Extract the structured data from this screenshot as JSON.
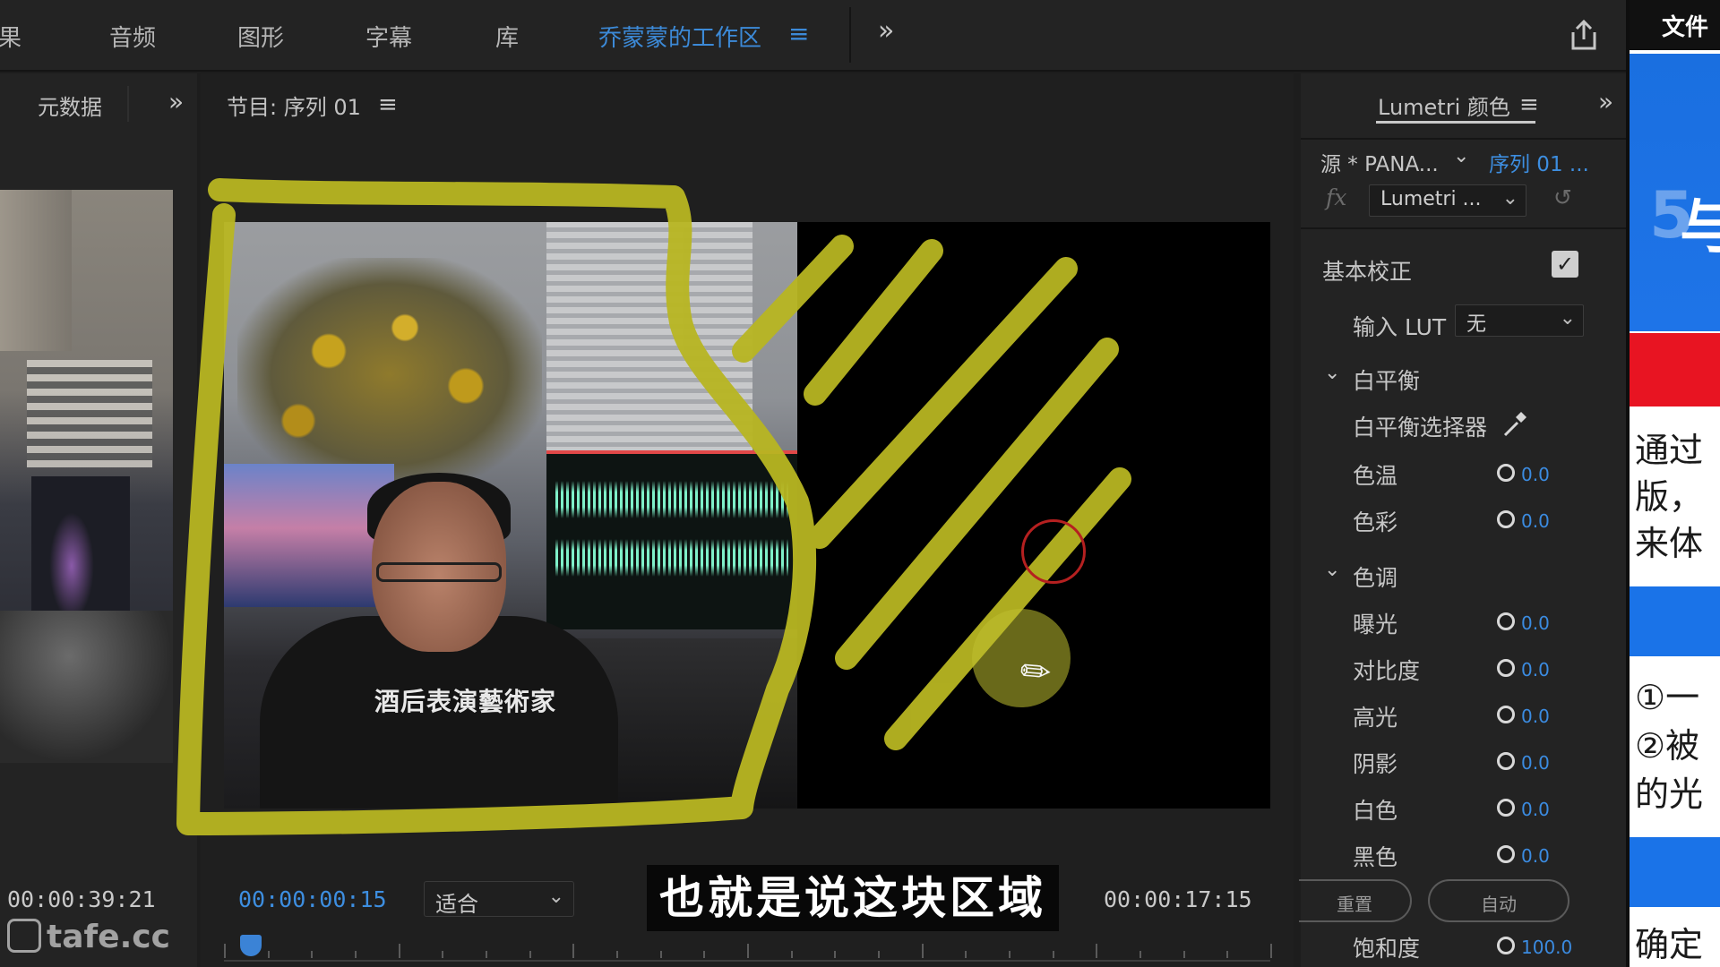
{
  "workspaces": {
    "tabs": [
      "果",
      "音频",
      "图形",
      "字幕",
      "库",
      "乔蒙蒙的工作区"
    ],
    "active_index": 5,
    "menu_glyph": "≡",
    "overflow_glyph": "»",
    "share_icon": "share-icon"
  },
  "left_panel": {
    "title": "元数据",
    "overflow_glyph": "»",
    "timecode": "00:00:39:21"
  },
  "program_monitor": {
    "title": "节目: 序列 01",
    "menu_glyph": "≡",
    "shirt_text": "酒后表演藝術家",
    "current_timecode": "00:00:00:15",
    "fit_label": "适合",
    "duration_timecode": "00:00:17:15",
    "playhead_fraction": 0.015
  },
  "subtitle": "也就是说这块区域",
  "watermark": "tafe.cc",
  "lumetri": {
    "title": "Lumetri 颜色",
    "menu_glyph": "≡",
    "overflow_glyph": "»",
    "source_label": "源 * PANA...",
    "sequence_label": "序列 01 ...",
    "fx_label": "fx",
    "effect_label": "Lumetri ...",
    "basic_correction": "基本校正",
    "basic_enabled": true,
    "input_lut_label": "输入 LUT",
    "input_lut_value": "无",
    "white_balance_header": "白平衡",
    "white_balance_picker": "白平衡选择器",
    "tone_header": "色调",
    "rows": [
      {
        "label": "色温",
        "value": "0.0"
      },
      {
        "label": "色彩",
        "value": "0.0"
      },
      {
        "label": "曝光",
        "value": "0.0"
      },
      {
        "label": "对比度",
        "value": "0.0"
      },
      {
        "label": "高光",
        "value": "0.0"
      },
      {
        "label": "阴影",
        "value": "0.0"
      },
      {
        "label": "白色",
        "value": "0.0"
      },
      {
        "label": "黑色",
        "value": "0.0"
      }
    ],
    "reset_label": "重置",
    "auto_label": "自动",
    "saturation_label": "饱和度",
    "saturation_value": "100.0"
  },
  "document": {
    "top_label": "文件",
    "lines": [
      "通过",
      "版，",
      "来体",
      "①一",
      "②被",
      "的光",
      "确定"
    ]
  },
  "colors": {
    "accent_blue": "#3d8ee0",
    "annotation_yellow": "#b8b622",
    "doc_red": "#e81422",
    "doc_blue": "#1a73e8"
  }
}
